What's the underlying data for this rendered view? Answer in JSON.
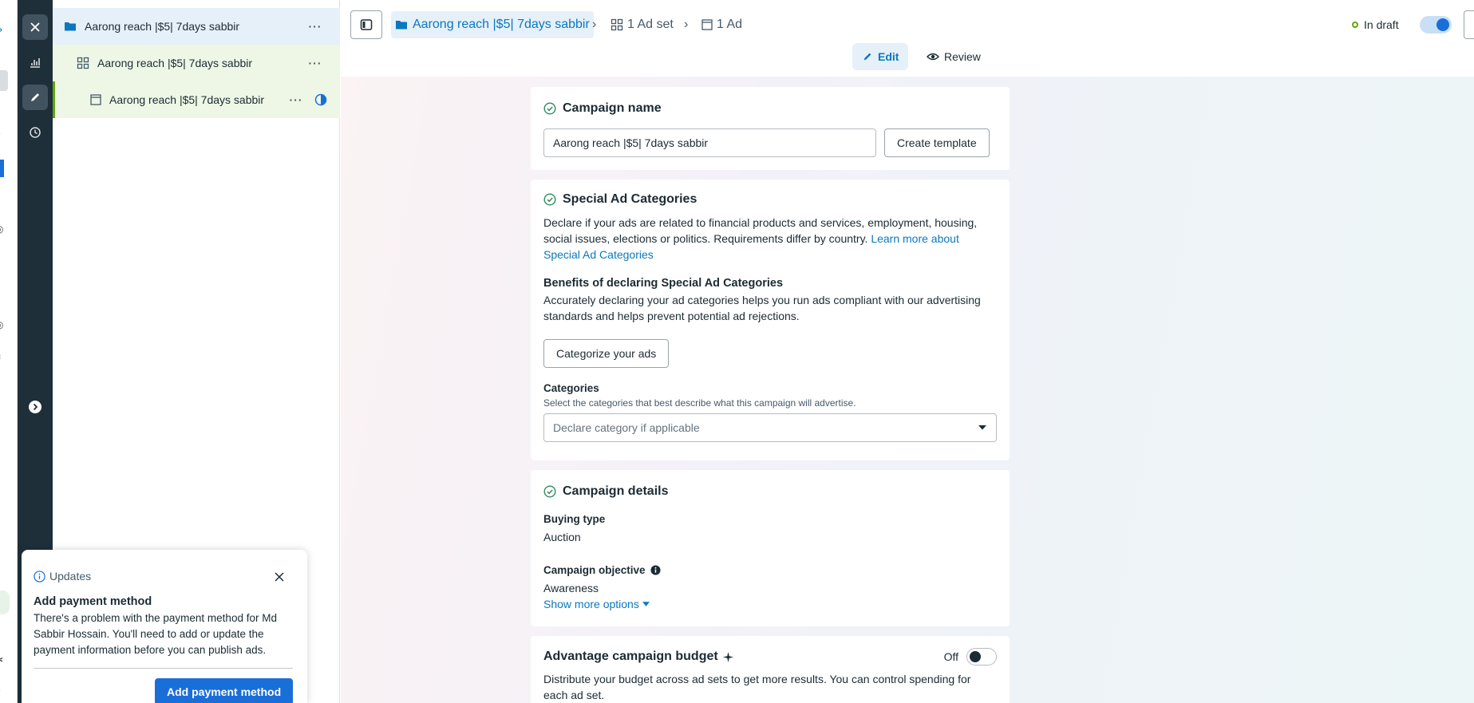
{
  "tree": {
    "campaign": "Aarong reach |$5| 7days sabbir",
    "adset": "Aarong reach |$5| 7days sabbir",
    "ad": "Aarong reach |$5| 7days sabbir",
    "more": "···"
  },
  "header": {
    "campaign_crumb": "Aarong reach |$5| 7days sabbir",
    "adset_crumb": "1 Ad set",
    "ad_crumb": "1 Ad",
    "status": "In draft",
    "tab_edit": "Edit",
    "tab_review": "Review"
  },
  "campaign_name": {
    "title": "Campaign name",
    "value": "Aarong reach |$5| 7days sabbir",
    "create_template": "Create template"
  },
  "special": {
    "title": "Special Ad Categories",
    "desc": "Declare if your ads are related to financial products and services, employment, housing, social issues, elections or politics. Requirements differ by country.",
    "learn_more": "Learn more about Special Ad Categories",
    "benefits_title": "Benefits of declaring Special Ad Categories",
    "benefits_desc": "Accurately declaring your ad categories helps you run ads compliant with our advertising standards and helps prevent potential ad rejections.",
    "categorize_button": "Categorize your ads",
    "categories_label": "Categories",
    "categories_help": "Select the categories that best describe what this campaign will advertise.",
    "categories_placeholder": "Declare category if applicable"
  },
  "details": {
    "title": "Campaign details",
    "buying_type_label": "Buying type",
    "buying_type_value": "Auction",
    "objective_label": "Campaign objective",
    "objective_value": "Awareness",
    "show_more": "Show more options"
  },
  "budget": {
    "title": "Advantage campaign budget",
    "toggle_label": "Off",
    "desc": "Distribute your budget across ad sets to get more results. You can control spending for each ad set."
  },
  "popup": {
    "header": "Updates",
    "title": "Add payment method",
    "body": "There's a problem with the payment method for Md Sabbir Hossain. You'll need to add or update the payment information before you can publish ads.",
    "button": "Add payment method"
  },
  "colors": {
    "brand_blue": "#0a78be",
    "button_blue": "#1a6ed8",
    "dark_rail": "#1f2f3a",
    "status_green": "#63a60f"
  }
}
